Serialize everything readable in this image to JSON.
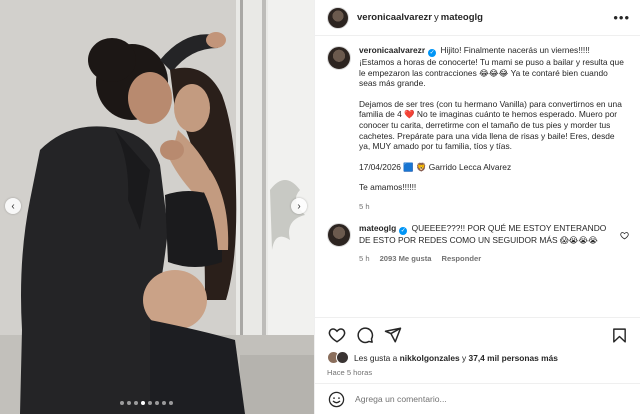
{
  "post": {
    "header": {
      "author": "veronicaalvarezr",
      "connector": "y",
      "collaborator": "mateoglg",
      "more_icon": "more-horizontal-icon"
    },
    "caption": {
      "username": "veronicaalvarezr",
      "text1": "Hijito! Finalmente nacerás un viernes!!!!! ¡Estamos a horas de conocerte! Tu mami se puso a bailar y resulta que le empezaron las contracciones 😂😂😂 Ya te contaré bien cuando seas más grande.",
      "text2": "Dejamos de ser tres (con tu hermano Vanilla) para convertirnos en una familia de 4 ❤️ No te imaginas cuánto te hemos esperado. Muero por conocer tu carita, derretirme con el tamaño de tus pies y morder tus cachetes. Prepárate para una vida llena de risas y baile! Eres, desde ya, MUY amado por tu familia, tíos y tías.",
      "text3": "17/04/2026 🟦 🦁 Garrido Lecca Alvarez",
      "text4": "Te amamos!!!!!!",
      "time": "5 h"
    },
    "comment": {
      "username": "mateoglg",
      "text": "QUEEEE???!! POR QUÉ ME ESTOY ENTERANDO DE ESTO POR REDES COMO UN SEGUIDOR MÁS 😱😭😭😭",
      "time": "5 h",
      "likes": "2093 Me gusta",
      "reply_label": "Responder"
    },
    "actions": {
      "icons": [
        "heart-icon",
        "comment-icon",
        "share-icon",
        "bookmark-icon"
      ]
    },
    "likes": {
      "prefix": "Les gusta a",
      "user": "nikkolgonzales",
      "middle": "y",
      "count": "37,4 mil personas más"
    },
    "posted_ago": "Hace 5 horas",
    "add_comment": {
      "placeholder": "Agrega un comentario..."
    },
    "carousel": {
      "total": 8,
      "active": 3
    }
  }
}
